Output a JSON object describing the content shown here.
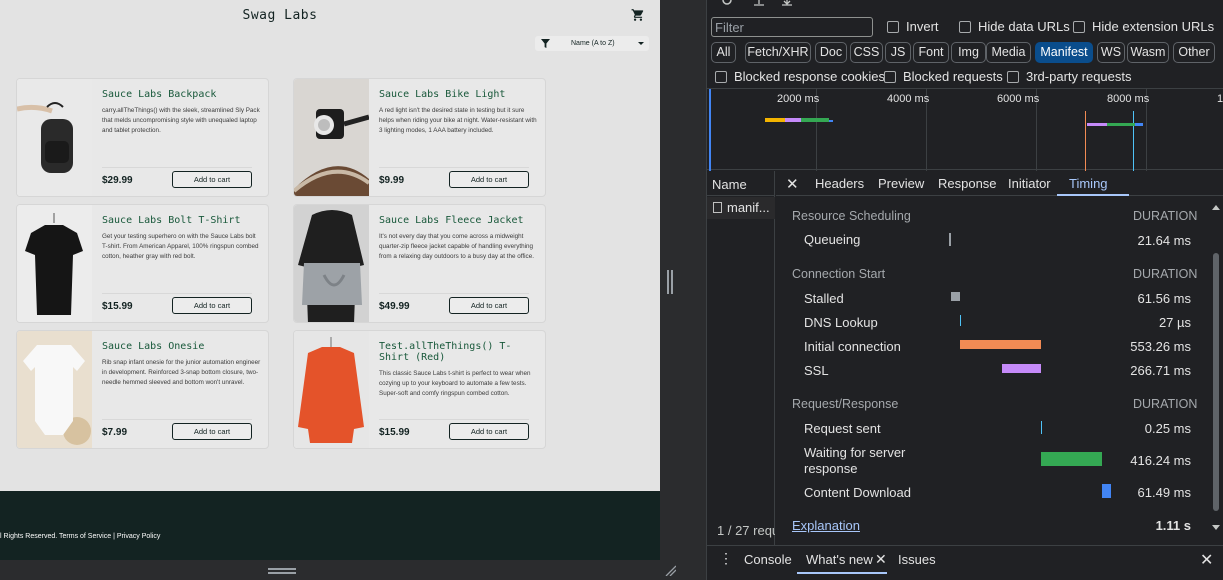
{
  "site": {
    "logo": "Swag Labs",
    "sort_label": "Name (A to Z)",
    "products": [
      {
        "title": "Sauce Labs Backpack",
        "desc": "carry.allTheThings() with the sleek, streamlined Sly Pack that melds uncompromising style with unequaled laptop and tablet protection.",
        "price": "$29.99",
        "button": "Add to cart"
      },
      {
        "title": "Sauce Labs Bike Light",
        "desc": "A red light isn't the desired state in testing but it sure helps when riding your bike at night. Water-resistant with 3 lighting modes, 1 AAA battery included.",
        "price": "$9.99",
        "button": "Add to cart"
      },
      {
        "title": "Sauce Labs Bolt T-Shirt",
        "desc": "Get your testing superhero on with the Sauce Labs bolt T-shirt. From American Apparel, 100% ringspun combed cotton, heather gray with red bolt.",
        "price": "$15.99",
        "button": "Add to cart"
      },
      {
        "title": "Sauce Labs Fleece Jacket",
        "desc": "It's not every day that you come across a midweight quarter-zip fleece jacket capable of handling everything from a relaxing day outdoors to a busy day at the office.",
        "price": "$49.99",
        "button": "Add to cart"
      },
      {
        "title": "Sauce Labs Onesie",
        "desc": "Rib snap infant onesie for the junior automation engineer in development. Reinforced 3-snap bottom closure, two-needle hemmed sleeved and bottom won't unravel.",
        "price": "$7.99",
        "button": "Add to cart"
      },
      {
        "title": "Test.allTheThings() T-Shirt (Red)",
        "desc": "This classic Sauce Labs t-shirt is perfect to wear when cozying up to your keyboard to automate a few tests. Super-soft and comfy ringspun combed cotton.",
        "price": "$15.99",
        "button": "Add to cart"
      }
    ],
    "footer": "l Rights Reserved. Terms of Service | Privacy Policy"
  },
  "devtools": {
    "filter_placeholder": "Filter",
    "checkboxes": [
      "Invert",
      "Hide data URLs",
      "Hide extension URLs",
      "Blocked response cookies",
      "Blocked requests",
      "3rd-party requests"
    ],
    "types": [
      "All",
      "Fetch/XHR",
      "Doc",
      "CSS",
      "JS",
      "Font",
      "Img",
      "Media",
      "Manifest",
      "WS",
      "Wasm",
      "Other"
    ],
    "active_type": "Manifest",
    "timeline_ticks": [
      "2000 ms",
      "4000 ms",
      "6000 ms",
      "8000 ms",
      "1"
    ],
    "name_header": "Name",
    "request_name": "manif...",
    "request_count": "1 / 27 requ",
    "tabs": [
      "Headers",
      "Preview",
      "Response",
      "Initiator",
      "Timing"
    ],
    "active_tab": "Timing",
    "timing": {
      "duration_label": "DURATION",
      "resource_scheduling": {
        "title": "Resource Scheduling",
        "rows": [
          {
            "label": "Queueing",
            "value": "21.64 ms"
          }
        ]
      },
      "connection_start": {
        "title": "Connection Start",
        "rows": [
          {
            "label": "Stalled",
            "value": "61.56 ms"
          },
          {
            "label": "DNS Lookup",
            "value": "27 µs"
          },
          {
            "label": "Initial connection",
            "value": "553.26 ms"
          },
          {
            "label": "SSL",
            "value": "266.71 ms"
          }
        ]
      },
      "request_response": {
        "title": "Request/Response",
        "rows": [
          {
            "label": "Request sent",
            "value": "0.25 ms"
          },
          {
            "label": "Waiting for server response",
            "value": "416.24 ms"
          },
          {
            "label": "Content Download",
            "value": "61.49 ms"
          }
        ]
      },
      "explanation": "Explanation",
      "total": "1.11 s"
    },
    "drawer": {
      "tabs": [
        "Console",
        "What's new",
        "Issues"
      ],
      "active": "What's new"
    },
    "colors": {
      "accent": "#a8c7fa",
      "manifest_active": "#0a4d8c",
      "initial_connection": "#f28b54",
      "ssl": "#c58af9",
      "waiting": "#34a853",
      "download": "#4285f4",
      "stalled": "#9aa0a6"
    }
  }
}
